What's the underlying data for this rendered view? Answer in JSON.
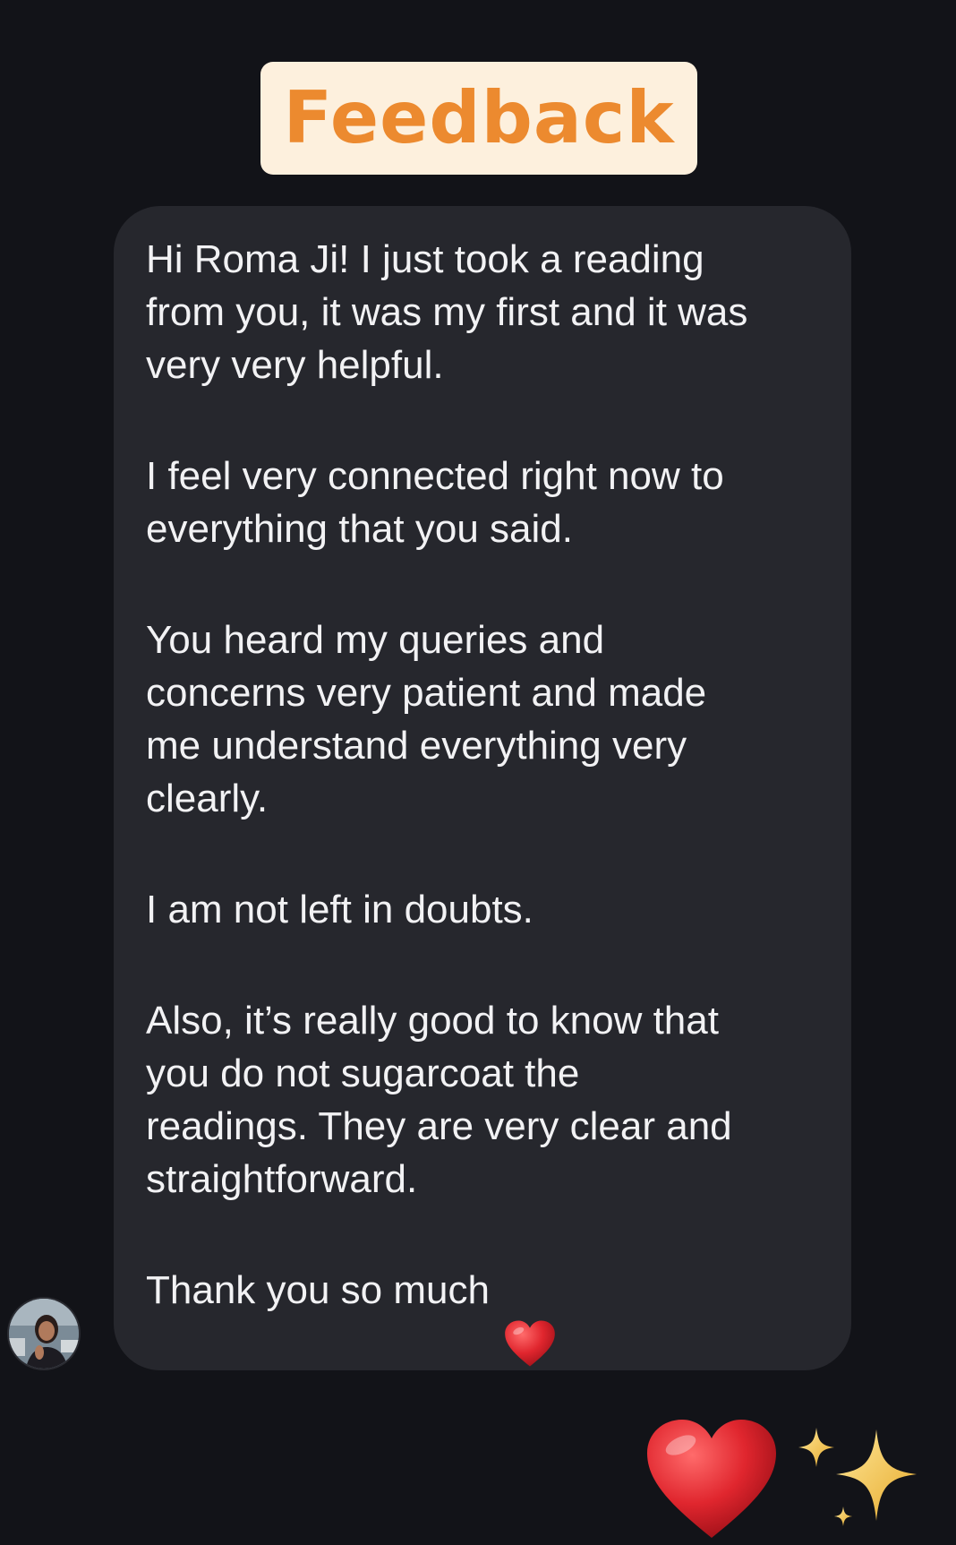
{
  "header": {
    "title": "Feedback"
  },
  "message": {
    "paragraphs": [
      "Hi Roma Ji! I just took a reading\nfrom you, it was my first and it was\nvery very helpful.",
      "I feel very connected right now to\neverything that you said.",
      "You heard my queries and\nconcerns very patient and made\nme understand everything very\nclearly.",
      "I am not left in doubts.",
      "Also, it’s really good to know that\nyou do not sugarcoat the\nreadings. They are very clear and\nstraightforward."
    ],
    "closing": "Thank you so much",
    "closing_emoji": "red-heart-icon"
  },
  "reactions": [
    "red-heart-icon",
    "sparkles-icon"
  ],
  "colors": {
    "background": "#121318",
    "bubble": "#26272d",
    "badge_bg": "#fdf0dd",
    "badge_text": "#ec8a2f",
    "message_text": "#f2f2f4",
    "heart": "#e0262e",
    "sparkle": "#f3c64a"
  }
}
